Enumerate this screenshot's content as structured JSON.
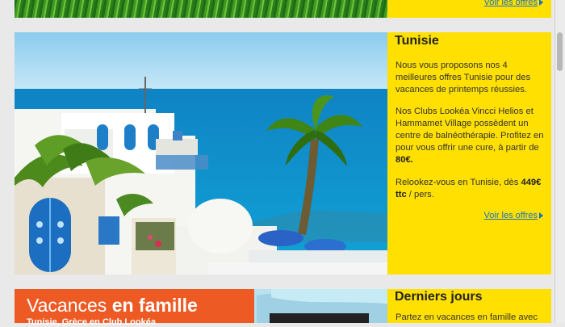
{
  "top": {
    "link": "Voir les offres"
  },
  "tunisia": {
    "title": "Tunisie",
    "paragraph1": "Nous vous proposons nos 4 meilleures offres Tunisie pour des vacances de printemps réussies.",
    "paragraph2_prefix": "Nos Clubs Lookéa Vincci Helios et Hammamet Village possèdent un centre de balnéothérapie. Profitez en pour vous offrir une cure, à partir de",
    "paragraph2_price": "80€.",
    "paragraph3_prefix": "Relookez-vous en Tunisie, dès",
    "paragraph3_price": "449€ ttc",
    "paragraph3_suffix": "/ pers.",
    "link": "Voir les offres"
  },
  "family": {
    "banner_prefix": "Vacances",
    "banner_highlight": "en famille",
    "banner_subtitle": "Tunisie, Grèce en Club Lookéa"
  },
  "last_days": {
    "title": "Derniers jours",
    "text": "Partez en vacances en famille avec"
  }
}
